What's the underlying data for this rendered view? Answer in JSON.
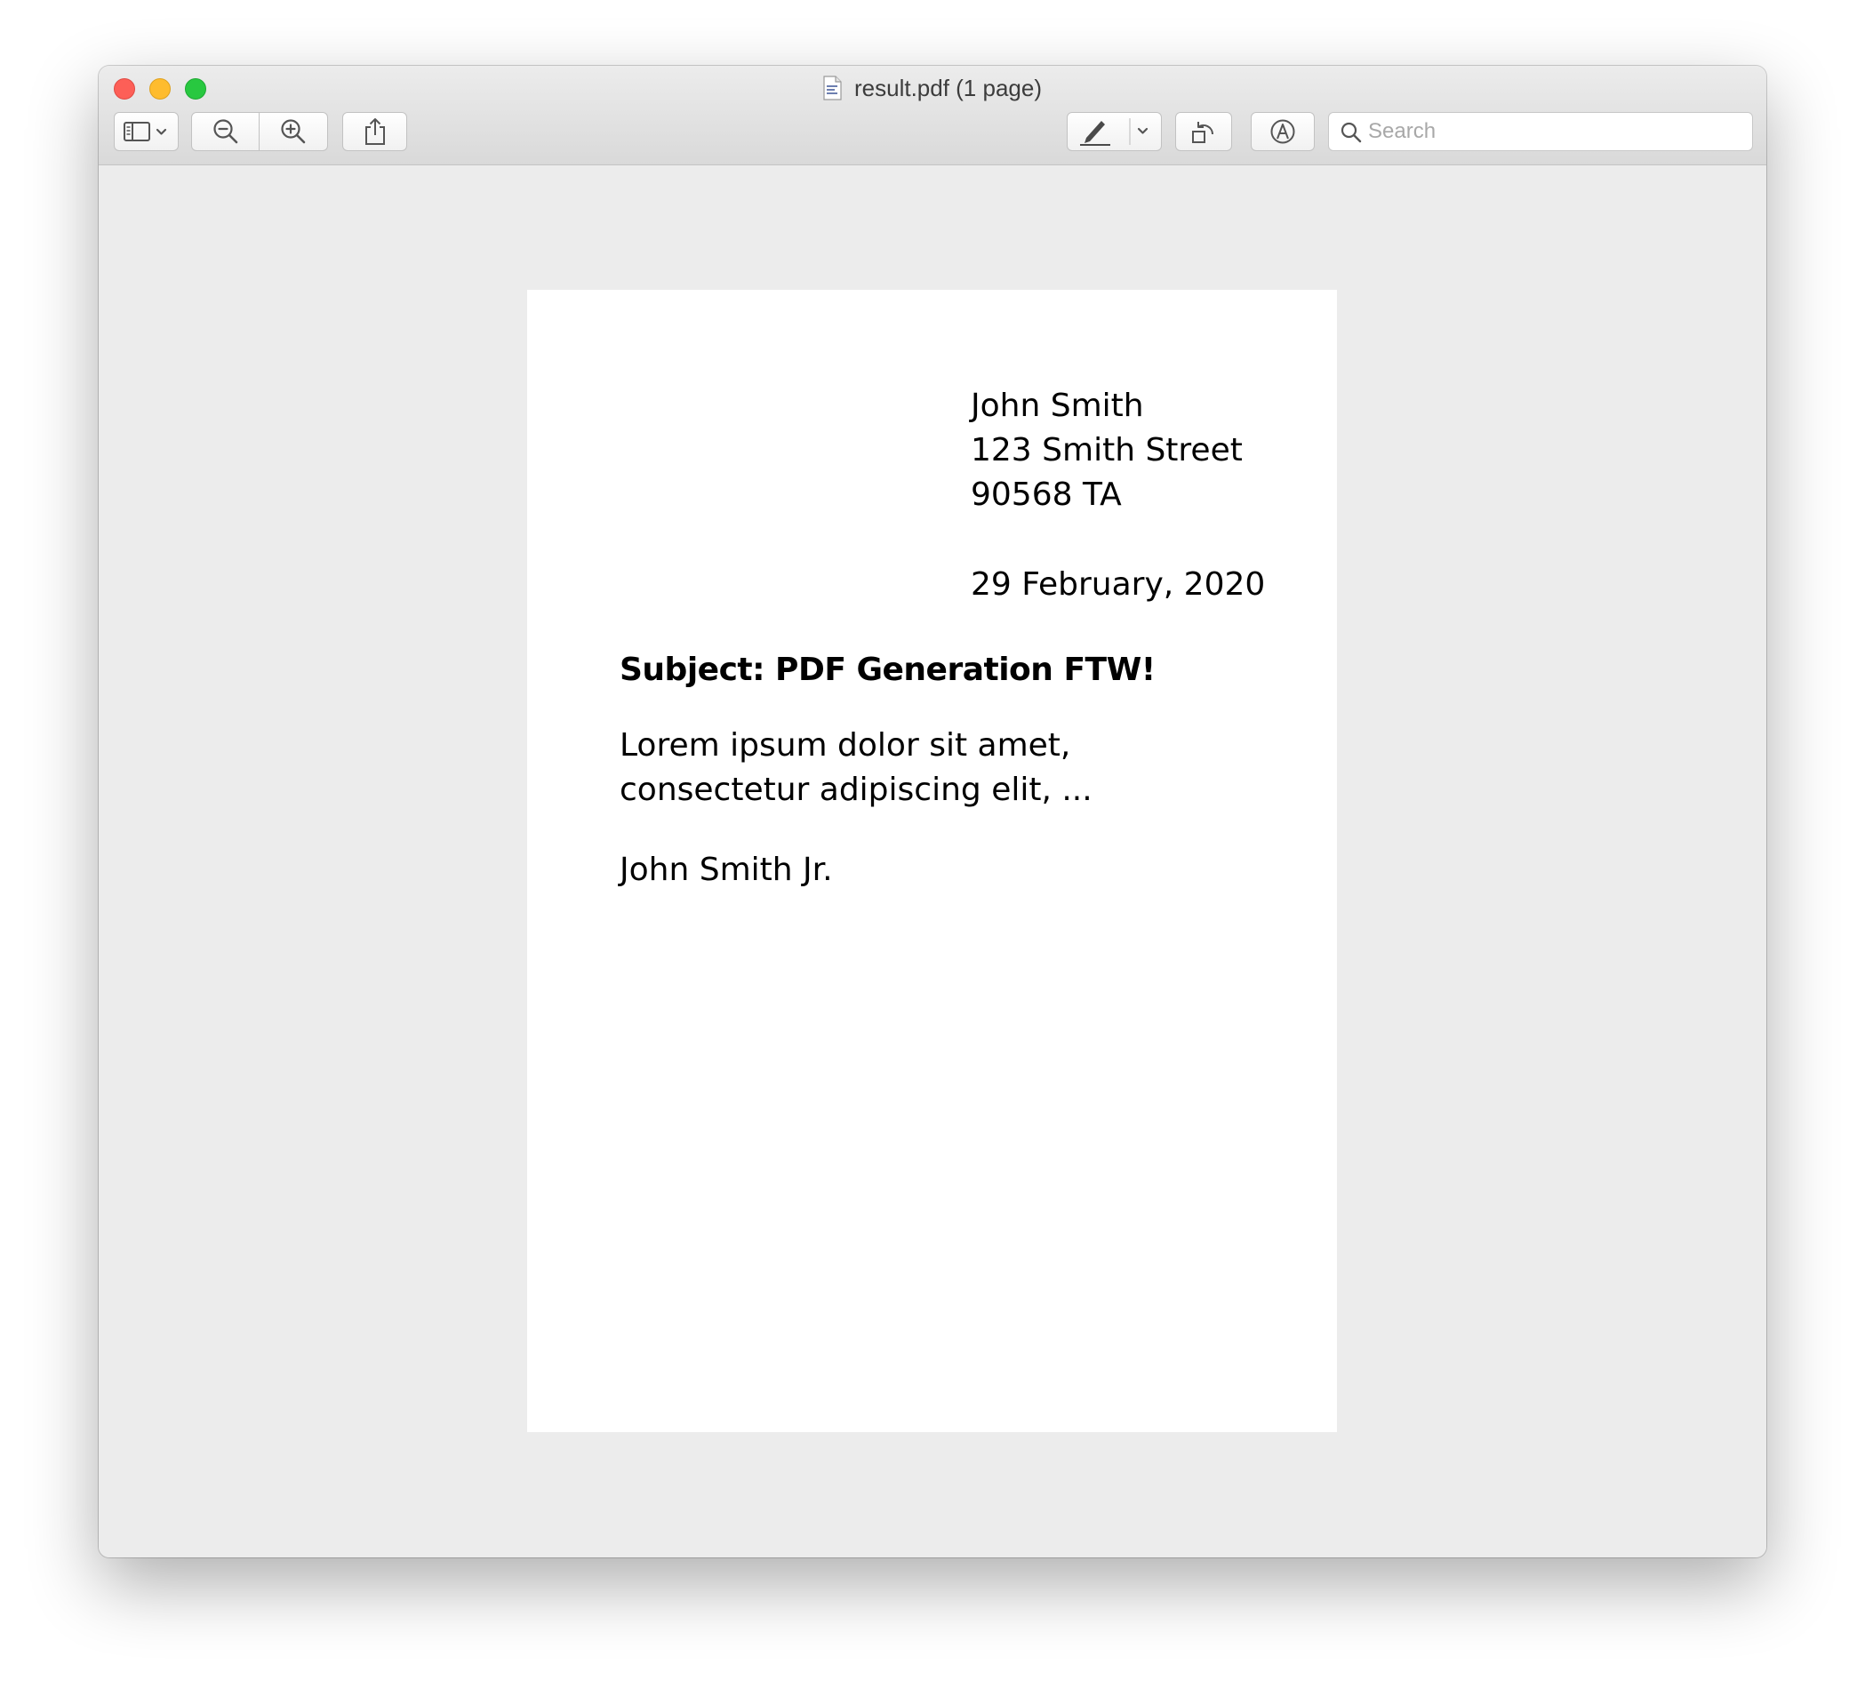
{
  "window": {
    "title": "result.pdf (1 page)"
  },
  "toolbar": {
    "search_placeholder": "Search"
  },
  "letter": {
    "sender_name": "John Smith",
    "sender_street": "123 Smith Street",
    "sender_city": "90568 TA",
    "date": "29 February, 2020",
    "subject": "Subject: PDF Generation FTW!",
    "body_line1": "Lorem ipsum dolor sit amet,",
    "body_line2": "consectetur adipiscing elit, ...",
    "signature": "John Smith Jr."
  },
  "icons": {
    "sidebar": "sidebar-icon",
    "zoom_out": "zoom-out-icon",
    "zoom_in": "zoom-in-icon",
    "share": "share-icon",
    "markup": "pen-icon",
    "rotate": "rotate-icon",
    "annotate": "markup-circle-icon",
    "search": "search-icon"
  }
}
